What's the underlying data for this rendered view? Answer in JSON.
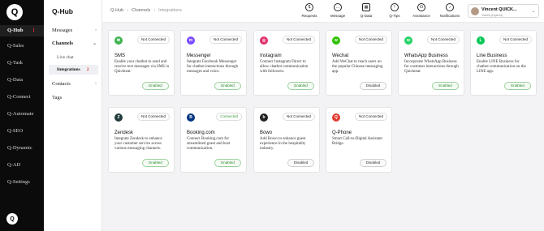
{
  "nav": {
    "logo": "Q",
    "items": [
      {
        "label": "Q-Hub",
        "active": true,
        "mark": "1"
      },
      {
        "label": "Q-Sales"
      },
      {
        "label": "Q-Task"
      },
      {
        "label": "Q-Data"
      },
      {
        "label": "Q-Connect"
      },
      {
        "label": "Q-Automate"
      },
      {
        "label": "Q-SEO"
      },
      {
        "label": "Q-Dynamic"
      },
      {
        "label": "Q-AD"
      },
      {
        "label": "Q-Settings"
      }
    ]
  },
  "sidebar": {
    "title": "Q-Hub",
    "messages": "Messages",
    "channels": "Channels",
    "live_chat": "Live chat",
    "integrations": "Integrations",
    "integrations_mark": "2",
    "contacts": "Contacts",
    "tags": "Tags"
  },
  "breadcrumb": {
    "a": "Q-Hub",
    "b": "Channels",
    "c": "Integrations"
  },
  "topbar": {
    "requests": "Requests",
    "message": "Message",
    "qdata": "Q-Data",
    "qtips": "Q-Tips",
    "assistance": "Assistance",
    "notifications": "Notifications",
    "user_name": "Vincent QUICK...",
    "user_sub": "Velvia (Hybrid)"
  },
  "cards": [
    {
      "name": "SMS",
      "status": "Not Connected",
      "desc": "Enable your chatbot to send and receive text messages via SMS in Quickteat.",
      "button": "Enabled",
      "btn_state": "enabled",
      "color": "#3fb34f",
      "glyph": "✉"
    },
    {
      "name": "Messenger",
      "status": "Not Connected",
      "desc": "Integrate Facebook Messenger for chatbot interactions through messages and voice.",
      "button": "Enabled",
      "btn_state": "enabled",
      "color": "#7b4dff",
      "glyph": "m"
    },
    {
      "name": "Instagram",
      "status": "Not Connected",
      "desc": "Connect Instagram Direct to allow chatbot communication with followers.",
      "button": "Enabled",
      "btn_state": "enabled",
      "color": "#e1306c",
      "glyph": "◎"
    },
    {
      "name": "Wechat",
      "status": "Not Connected",
      "desc": "Add WeChat to reach users on the popular Chinese messaging app.",
      "button": "Disabled",
      "btn_state": "disabled",
      "color": "#2dc100",
      "glyph": "w"
    },
    {
      "name": "WhatsApp Business",
      "status": "Not Connected",
      "desc": "Incorporate WhatsApp Business for customer interactions through Quickteat.",
      "button": "Enabled",
      "btn_state": "enabled",
      "color": "#25d366",
      "glyph": "w"
    },
    {
      "name": "Line Business",
      "status": "Not Connected",
      "desc": "Enable LINE Business for chatbot communication on the LINE app.",
      "button": "Enabled",
      "btn_state": "enabled",
      "color": "#06c755",
      "glyph": "L"
    },
    {
      "name": "Zendesk",
      "status": "Not Connected",
      "desc": "Integrate Zendesk to enhance your customer service across various messaging channels.",
      "button": "Enabled",
      "btn_state": "enabled",
      "color": "#1f3b3b",
      "glyph": "Z"
    },
    {
      "name": "Booking.com",
      "status": "Connected",
      "desc": "Connect Booking.com for streamlined guest and host communication.",
      "button": "Enabled",
      "btn_state": "enabled",
      "color": "#003580",
      "glyph": "B"
    },
    {
      "name": "Bowo",
      "status": "Not Connected",
      "desc": "Add Bowo to enhance guest experience in the hospitality industry.",
      "button": "Disabled",
      "btn_state": "disabled",
      "color": "#222222",
      "glyph": "b"
    },
    {
      "name": "Q-Phone",
      "status": "Not Connected",
      "desc": "Smart Call-to-Digital Assistant Bridge.",
      "button": "Disabled",
      "btn_state": "disabled",
      "color": "#e23c32",
      "glyph": "Q"
    }
  ]
}
